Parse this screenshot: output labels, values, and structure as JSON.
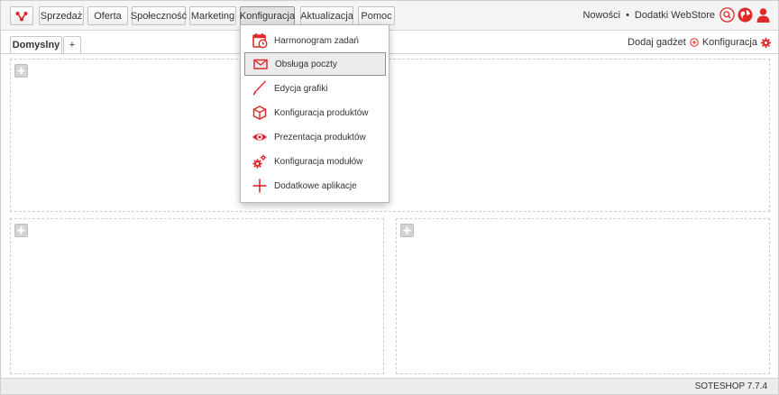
{
  "nav": {
    "items": [
      {
        "label": "Sprzedaż"
      },
      {
        "label": "Oferta"
      },
      {
        "label": "Społeczność"
      },
      {
        "label": "Marketing"
      },
      {
        "label": "Konfiguracja"
      },
      {
        "label": "Aktualizacja"
      },
      {
        "label": "Pomoc"
      }
    ],
    "active": "Konfiguracja",
    "right_links": {
      "news": "Nowości",
      "sep": "•",
      "webstore": "Dodatki WebStore"
    },
    "right_icons": [
      "search-icon",
      "globe-icon",
      "user-icon"
    ]
  },
  "tabs": {
    "items": [
      {
        "label": "Domyslny"
      },
      {
        "label": "+"
      }
    ],
    "actions": {
      "add_gadget": "Dodaj gadżet",
      "config": "Konfiguracja"
    }
  },
  "menu": {
    "items": [
      {
        "label": "Harmonogram zadań",
        "icon": "calendar-clock-icon"
      },
      {
        "label": "Obsługa poczty",
        "icon": "envelope-icon"
      },
      {
        "label": "Edycja grafiki",
        "icon": "brush-icon"
      },
      {
        "label": "Konfiguracja produktów",
        "icon": "box-icon"
      },
      {
        "label": "Prezentacja produktów",
        "icon": "eye-icon"
      },
      {
        "label": "Konfiguracja modułów",
        "icon": "gears-icon"
      },
      {
        "label": "Dodatkowe aplikacje",
        "icon": "plus-icon"
      }
    ],
    "highlighted": "Obsługa poczty"
  },
  "footer": {
    "version": "SOTESHOP 7.7.4"
  },
  "colors": {
    "accent": "#e02a2a",
    "bar": "#f4f4f4"
  }
}
